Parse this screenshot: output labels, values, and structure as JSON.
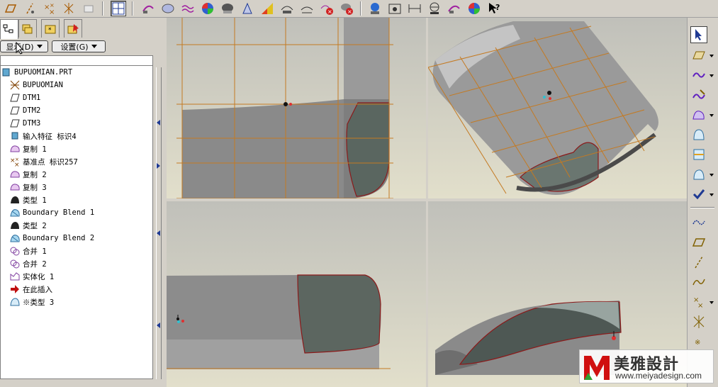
{
  "toolbar": {
    "icons": [
      "datum-plane-display-icon",
      "datum-axis-display-icon",
      "datum-point-display-icon",
      "coordinate-system-display-icon",
      "spin-center-icon",
      "refit-icon",
      "regenerate-icon",
      "shaded-icon",
      "hidden-line-icon",
      "wireframe-icon",
      "no-hidden-icon",
      "draft-analysis-icon",
      "curvature-icon",
      "surface-analysis-icon",
      "dihedral-icon",
      "measure-icon",
      "section-icon",
      "reflection-icon",
      "model-tree-icon",
      "saved-views-icon",
      "orient-icon",
      "zoom-in-icon",
      "zoom-out-icon",
      "color-icon",
      "context-help-icon"
    ]
  },
  "left_panel": {
    "tabs": [
      "model-tree-tab",
      "layer-tree-tab",
      "folder-browser-tab",
      "favorites-tab"
    ],
    "display_button": "显示(D)",
    "settings_button": "设置(G)",
    "tree_items": [
      {
        "label": "BUPUOMIAN.PRT",
        "icon": "part-icon"
      },
      {
        "label": "BUPUOMIAN",
        "icon": "coordinate-system-icon"
      },
      {
        "label": "DTM1",
        "icon": "datum-plane-icon"
      },
      {
        "label": "DTM2",
        "icon": "datum-plane-icon"
      },
      {
        "label": "DTM3",
        "icon": "datum-plane-icon"
      },
      {
        "label": "输入特征 标识4",
        "icon": "import-feature-icon"
      },
      {
        "label": "复制 1",
        "icon": "surface-copy-icon"
      },
      {
        "label": "基准点 标识257",
        "icon": "datum-point-icon"
      },
      {
        "label": "复制 2",
        "icon": "surface-copy-icon"
      },
      {
        "label": "复制 3",
        "icon": "surface-copy-icon"
      },
      {
        "label": "类型 1",
        "icon": "type-feature-icon"
      },
      {
        "label": "Boundary Blend 1",
        "icon": "boundary-blend-icon"
      },
      {
        "label": "类型 2",
        "icon": "type-feature-icon"
      },
      {
        "label": "Boundary Blend 2",
        "icon": "boundary-blend-icon"
      },
      {
        "label": "合并 1",
        "icon": "merge-icon"
      },
      {
        "label": "合并 2",
        "icon": "merge-icon"
      },
      {
        "label": "实体化 1",
        "icon": "solidify-icon"
      },
      {
        "label": "在此插入",
        "icon": "insert-here-arrow-icon"
      },
      {
        "label": "※类型 3",
        "icon": "type-feature-pending-icon"
      }
    ]
  },
  "right_toolbar": {
    "icons": [
      "select-arrow-icon",
      "surface-icon",
      "curve-icon",
      "curve-edit-icon",
      "boundary-blend-tool-icon",
      "surface-trim-icon",
      "surface-offset-icon",
      "surface-transform-icon",
      "done-check-icon",
      "analysis-curve-icon",
      "plane-icon",
      "axis-line-icon",
      "curve-tool-icon",
      "point-tool-icon",
      "point-cloud-icon",
      "more-icon"
    ]
  },
  "watermark": {
    "title": "美雅設計",
    "url": "www.meiyadesign.com"
  },
  "colors": {
    "background": "#d4d0c8",
    "viewport_top": "#c0c0ba",
    "viewport_bottom": "#e2dfcb",
    "grid": "#c47a22",
    "accent": "#1f3a93"
  }
}
